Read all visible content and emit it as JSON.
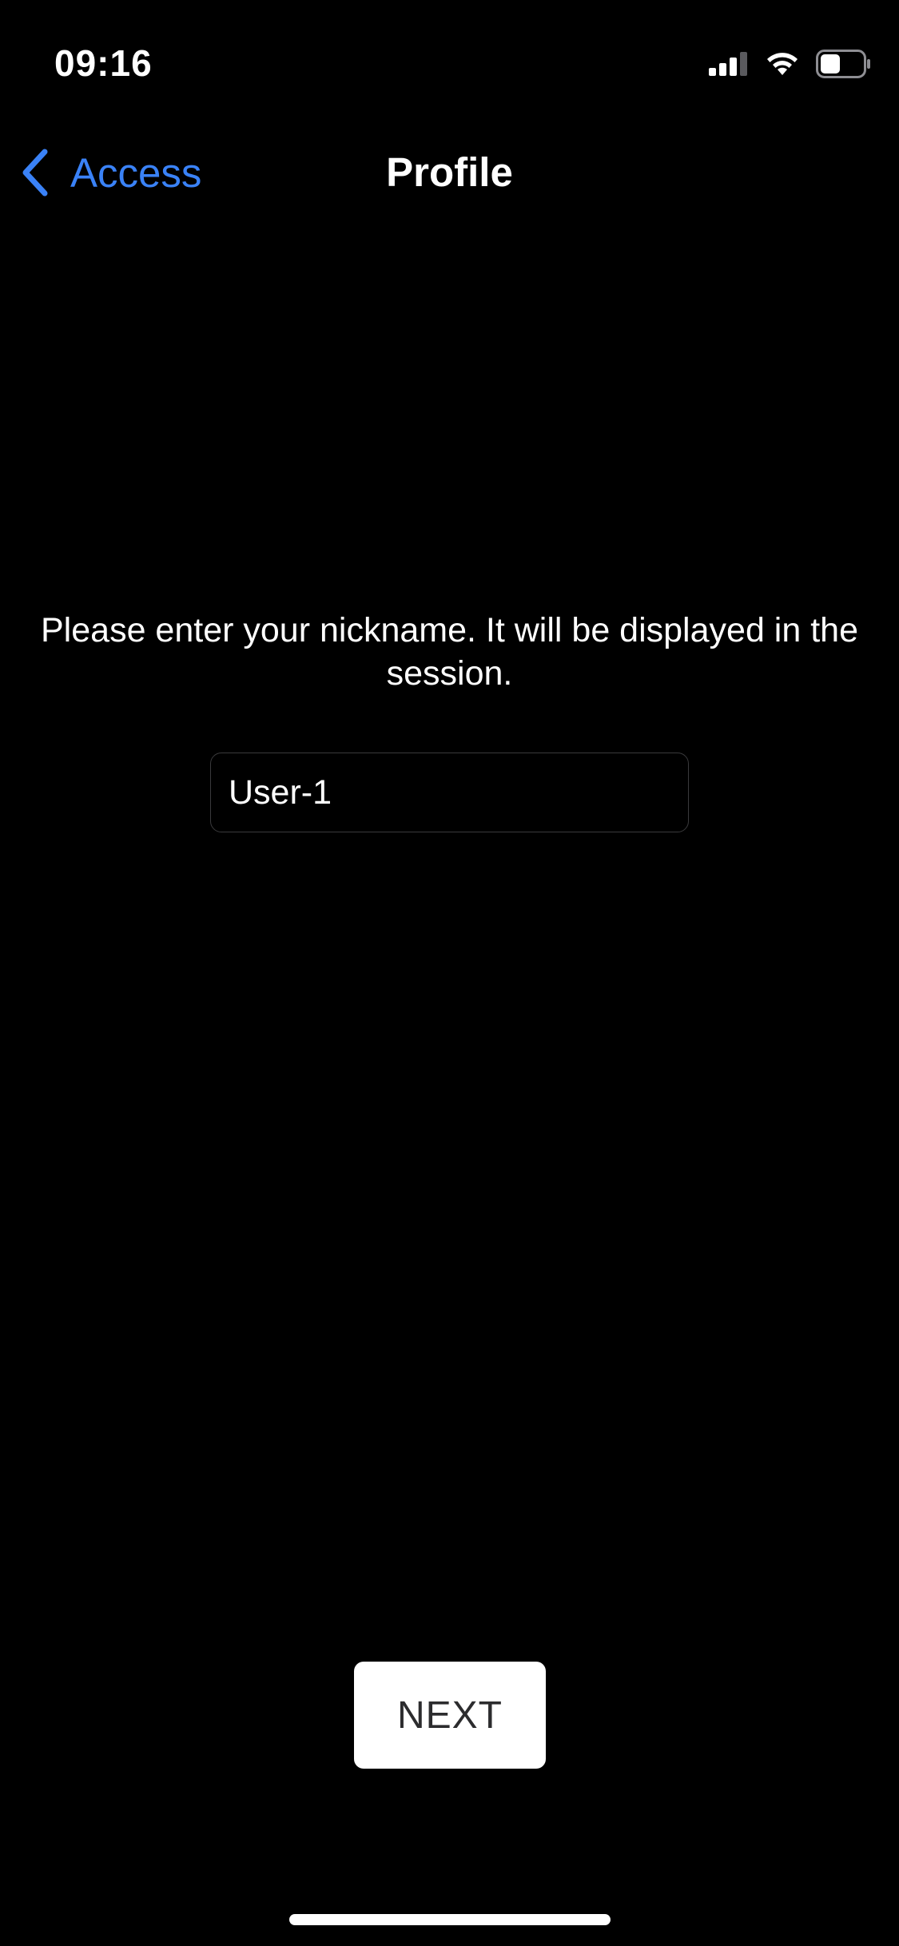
{
  "status_bar": {
    "time": "09:16",
    "icons": [
      "cellular-signal-icon",
      "wifi-icon",
      "battery-icon"
    ]
  },
  "nav": {
    "back_label": "Access",
    "title": "Profile"
  },
  "main": {
    "prompt": "Please enter your nickname. It will be displayed in the session.",
    "nickname_value": "User-1",
    "next_label": "NEXT"
  },
  "colors": {
    "background": "#000000",
    "accent": "#3a82f7",
    "text": "#ffffff",
    "button_bg": "#ffffff",
    "button_text": "#2c2c2e"
  }
}
